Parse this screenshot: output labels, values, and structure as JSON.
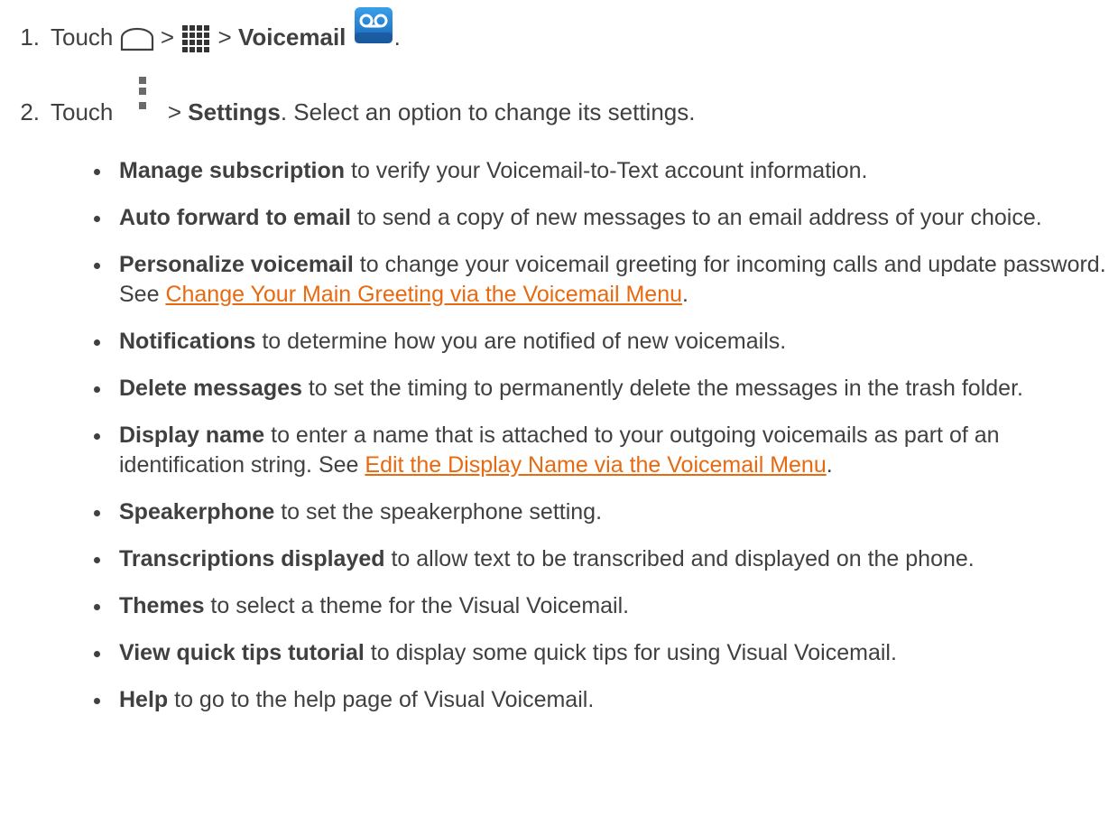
{
  "steps": [
    {
      "number": "1.",
      "pre": "Touch",
      "sep1": ">",
      "sep2": ">",
      "bold": "Voicemail",
      "post": ".",
      "icons": [
        "home-icon",
        "apps-grid-icon",
        "voicemail-app-icon"
      ]
    },
    {
      "number": "2.",
      "pre": "Touch",
      "sep": ">",
      "bold": "Settings",
      "post": ". Select an option to change its settings.",
      "icons": [
        "menu-icon"
      ]
    }
  ],
  "options": [
    {
      "term": "Manage subscription",
      "desc": " to verify your Voicemail-to-Text account information."
    },
    {
      "term": "Auto forward to email",
      "desc": " to send a copy of new messages to an email address of your choice."
    },
    {
      "term": "Personalize voicemail",
      "desc": " to change your voicemail greeting for incoming calls and update password. See ",
      "link": "Change Your Main Greeting via the Voicemail Menu",
      "after": "."
    },
    {
      "term": "Notifications",
      "desc": " to determine how you are notified of new voicemails."
    },
    {
      "term": "Delete messages",
      "desc": " to set the timing to permanently delete the messages in the trash folder."
    },
    {
      "term": "Display name",
      "desc": " to enter a name that is attached to your outgoing voicemails as part of an identification string. See ",
      "link": "Edit the Display Name via the Voicemail Menu",
      "after": "."
    },
    {
      "term": "Speakerphone",
      "desc": " to set the speakerphone setting."
    },
    {
      "term": "Transcriptions displayed",
      "desc": " to allow text to be transcribed and displayed on the phone."
    },
    {
      "term": "Themes",
      "desc": " to select a theme for the Visual Voicemail."
    },
    {
      "term": "View quick tips tutorial",
      "desc": " to display some quick tips for using Visual Voicemail."
    },
    {
      "term": "Help",
      "desc": " to go to the help page of Visual Voicemail."
    }
  ],
  "colors": {
    "text": "#404040",
    "link": "#e86a10",
    "voicemail_icon": "#1c83d4"
  }
}
